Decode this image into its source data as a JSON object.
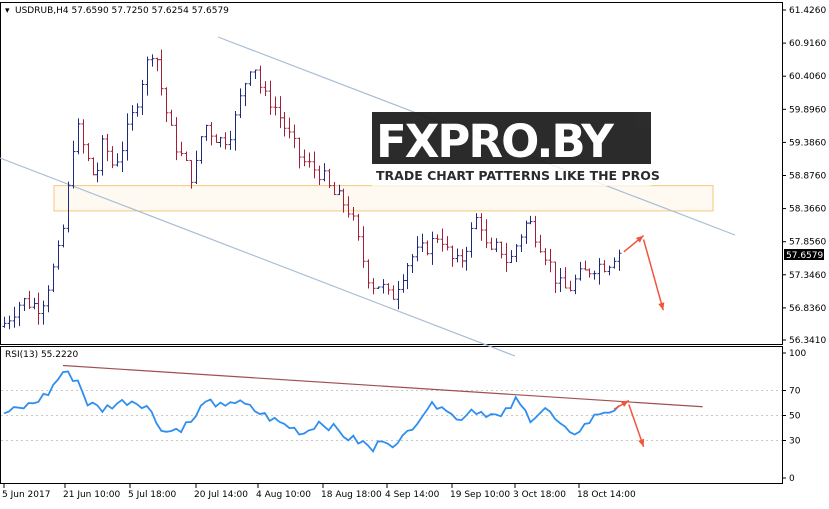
{
  "price_header": "USDRUB,H4  57.6590 57.7250 57.6254 57.6579",
  "current_price_label": "57.6579",
  "rsi_header": "RSI(13) 55.2220",
  "watermark": {
    "brand": "FXPRO.BY",
    "tagline": "TRADE CHART PATTERNS LIKE THE PROS"
  },
  "colors": {
    "bull_candle": "#1f2a7a",
    "bear_candle": "#a0203a",
    "rsi_line": "#2f8ff0",
    "rsi_trendline": "#a05050",
    "channel_line": "#a9bfd6",
    "support_zone": "#f5c87a",
    "forecast_arrow": "#f0553c",
    "brand_dark": "#1a1a1a",
    "brand_red": "#e8312a"
  },
  "chart_data": [
    {
      "type": "candlestick",
      "symbol": "USDRUB",
      "timeframe": "H4",
      "ohlc_last": {
        "open": 57.659,
        "high": 57.725,
        "low": 57.6254,
        "close": 57.6579
      },
      "ylim": [
        56.341,
        61.4262
      ],
      "y_ticks": [
        "61.4260",
        "60.9160",
        "60.4060",
        "59.8960",
        "59.3860",
        "58.8760",
        "58.3660",
        "57.8560",
        "57.3460",
        "56.8360",
        "56.3410"
      ],
      "x_tick_labels": [
        "5 Jun 2017",
        "21 Jun 10:00",
        "5 Jul 18:00",
        "20 Jul 14:00",
        "4 Aug 10:00",
        "18 Aug 18:00",
        "4 Sep 14:00",
        "19 Sep 10:00",
        "3 Oct 18:00",
        "18 Oct 14:00"
      ],
      "close_path_anchors": [
        [
          0,
          56.55
        ],
        [
          4,
          56.95
        ],
        [
          8,
          56.85
        ],
        [
          10,
          57.3
        ],
        [
          12,
          57.8
        ],
        [
          13,
          58.3
        ],
        [
          15,
          59.7
        ],
        [
          17,
          59.2
        ],
        [
          19,
          58.8
        ],
        [
          21,
          59.5
        ],
        [
          22,
          59.0
        ],
        [
          24,
          59.2
        ],
        [
          27,
          59.9
        ],
        [
          29,
          60.5
        ],
        [
          31,
          60.9
        ],
        [
          33,
          60.0
        ],
        [
          35,
          59.4
        ],
        [
          37,
          59.1
        ],
        [
          39,
          58.8
        ],
        [
          41,
          59.7
        ],
        [
          43,
          59.5
        ],
        [
          45,
          59.4
        ],
        [
          47,
          59.6
        ],
        [
          49,
          60.2
        ],
        [
          51,
          60.7
        ],
        [
          53,
          60.1
        ],
        [
          55,
          60.0
        ],
        [
          57,
          59.7
        ],
        [
          59,
          59.4
        ],
        [
          61,
          59.1
        ],
        [
          63,
          59.0
        ],
        [
          65,
          58.9
        ],
        [
          67,
          58.6
        ],
        [
          69,
          58.5
        ],
        [
          71,
          58.3
        ],
        [
          73,
          57.7
        ],
        [
          75,
          57.2
        ],
        [
          77,
          57.2
        ],
        [
          79,
          56.95
        ],
        [
          81,
          57.3
        ],
        [
          83,
          57.6
        ],
        [
          85,
          57.7
        ],
        [
          87,
          57.8
        ],
        [
          89,
          58.0
        ],
        [
          91,
          57.6
        ],
        [
          93,
          57.5
        ],
        [
          95,
          57.9
        ],
        [
          97,
          58.3
        ],
        [
          99,
          57.6
        ],
        [
          101,
          57.8
        ],
        [
          103,
          57.5
        ],
        [
          105,
          57.9
        ],
        [
          107,
          58.2
        ],
        [
          109,
          57.9
        ],
        [
          111,
          57.6
        ],
        [
          113,
          57.2
        ],
        [
          115,
          57.1
        ],
        [
          117,
          57.3
        ],
        [
          119,
          57.4
        ],
        [
          121,
          57.5
        ],
        [
          123,
          57.5
        ],
        [
          125,
          57.7
        ]
      ],
      "support_zone": [
        58.33,
        58.72
      ],
      "channel_upper": [
        [
          48,
          61.05
        ],
        [
          126,
          57.95
        ]
      ],
      "channel_lower": [
        [
          0,
          59.2
        ],
        [
          88,
          56.45
        ]
      ],
      "forecast": [
        [
          126,
          57.7
        ],
        [
          130,
          57.95
        ],
        [
          134,
          56.8
        ]
      ]
    },
    {
      "type": "line",
      "name": "RSI(13)",
      "last_value": 55.222,
      "ylim": [
        0,
        100
      ],
      "y_ticks": [
        100,
        70,
        50,
        30,
        0
      ],
      "anchors": [
        [
          0,
          52
        ],
        [
          3,
          55
        ],
        [
          6,
          60
        ],
        [
          9,
          68
        ],
        [
          12,
          85
        ],
        [
          15,
          78
        ],
        [
          17,
          60
        ],
        [
          20,
          55
        ],
        [
          23,
          60
        ],
        [
          26,
          62
        ],
        [
          29,
          58
        ],
        [
          31,
          45
        ],
        [
          33,
          37
        ],
        [
          36,
          40
        ],
        [
          39,
          48
        ],
        [
          41,
          64
        ],
        [
          43,
          55
        ],
        [
          46,
          62
        ],
        [
          49,
          58
        ],
        [
          52,
          52
        ],
        [
          55,
          46
        ],
        [
          58,
          41
        ],
        [
          61,
          36
        ],
        [
          64,
          45
        ],
        [
          67,
          40
        ],
        [
          70,
          32
        ],
        [
          73,
          28
        ],
        [
          75,
          22
        ],
        [
          77,
          32
        ],
        [
          80,
          26
        ],
        [
          83,
          42
        ],
        [
          86,
          56
        ],
        [
          89,
          60
        ],
        [
          92,
          46
        ],
        [
          95,
          55
        ],
        [
          98,
          52
        ],
        [
          101,
          48
        ],
        [
          104,
          62
        ],
        [
          107,
          48
        ],
        [
          110,
          56
        ],
        [
          113,
          42
        ],
        [
          115,
          34
        ],
        [
          118,
          42
        ],
        [
          121,
          52
        ],
        [
          124,
          55
        ]
      ],
      "trendline": [
        [
          12,
          90
        ],
        [
          142,
          57
        ]
      ],
      "forecast": [
        [
          124,
          55
        ],
        [
          127,
          62
        ],
        [
          130,
          25
        ]
      ]
    }
  ]
}
